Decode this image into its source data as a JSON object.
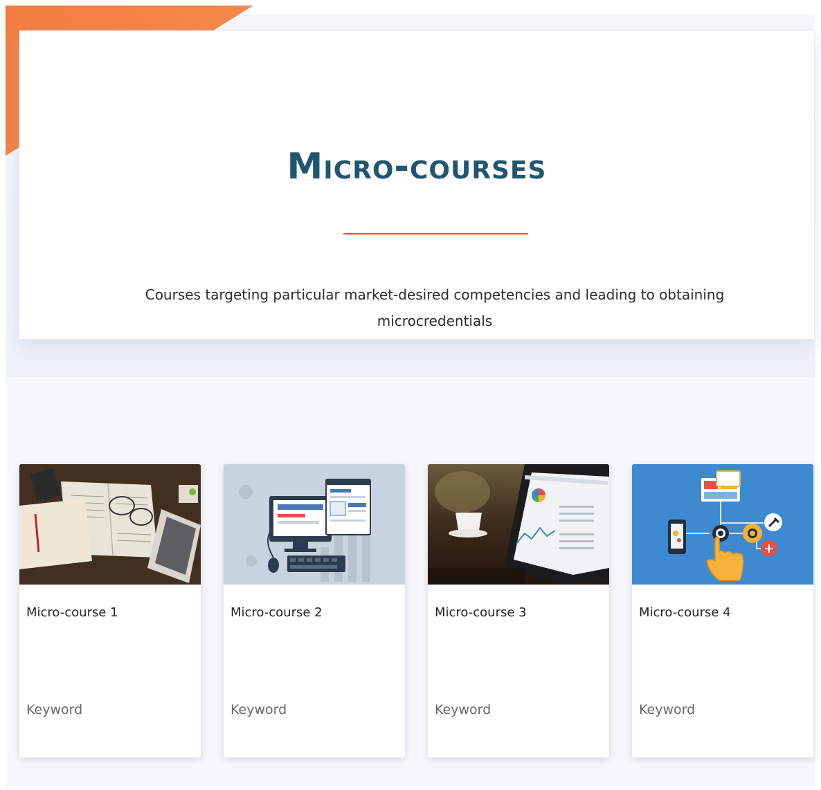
{
  "hero": {
    "title": "Micro-courses",
    "subtitle": "Courses targeting particular market-desired competencies and leading to obtaining microcredentials"
  },
  "colors": {
    "accent": "#f07a3e",
    "title": "#1f5670",
    "divider": "#e8572a"
  },
  "courses": [
    {
      "title": "Micro-course 1",
      "keyword": "Keyword",
      "image": "books-and-tablet-photo"
    },
    {
      "title": "Micro-course 2",
      "keyword": "Keyword",
      "image": "computer-illustration"
    },
    {
      "title": "Micro-course 3",
      "keyword": "Keyword",
      "image": "tablet-analytics-photo"
    },
    {
      "title": "Micro-course 4",
      "keyword": "Keyword",
      "image": "digital-touch-illustration"
    }
  ]
}
